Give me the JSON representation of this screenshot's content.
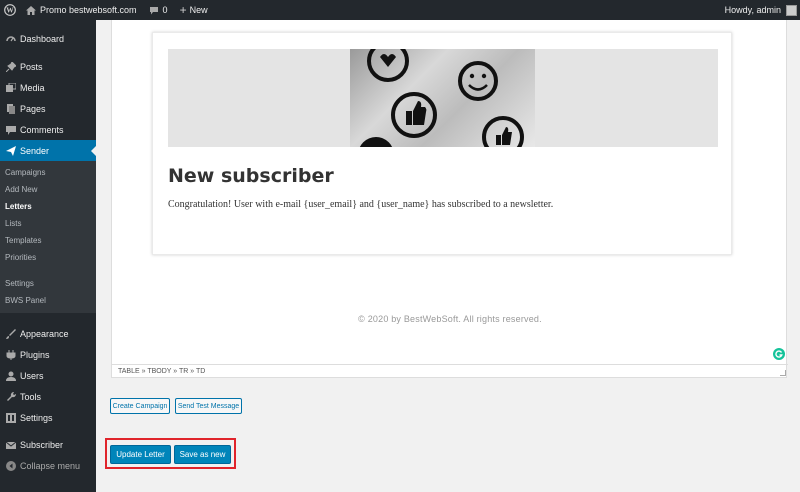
{
  "adminbar": {
    "site_name": "Promo bestwebsoft.com",
    "comments_count": "0",
    "new_label": "New",
    "howdy": "Howdy, admin"
  },
  "sidebar": {
    "top_items": [
      {
        "label": "Dashboard",
        "icon": "dashboard-icon"
      },
      {
        "label": "Posts",
        "icon": "pin-icon"
      },
      {
        "label": "Media",
        "icon": "media-icon"
      },
      {
        "label": "Pages",
        "icon": "page-icon"
      },
      {
        "label": "Comments",
        "icon": "comment-icon"
      },
      {
        "label": "Sender",
        "icon": "send-icon"
      }
    ],
    "submenu": [
      "Campaigns",
      "Add New",
      "Letters",
      "Lists",
      "Templates",
      "Priorities",
      "Settings",
      "BWS Panel"
    ],
    "bottom_items": [
      {
        "label": "Appearance",
        "icon": "brush-icon"
      },
      {
        "label": "Plugins",
        "icon": "plug-icon"
      },
      {
        "label": "Users",
        "icon": "users-icon"
      },
      {
        "label": "Tools",
        "icon": "wrench-icon"
      },
      {
        "label": "Settings",
        "icon": "settings-icon"
      },
      {
        "label": "Subscriber",
        "icon": "subscriber-icon"
      },
      {
        "label": "Collapse menu",
        "icon": "collapse-icon"
      }
    ]
  },
  "letter": {
    "title": "New subscriber",
    "body": "Congratulation! User with e-mail {user_email} and {user_name} has subscribed to a newsletter.",
    "footer": "© 2020 by BestWebSoft. All rights reserved."
  },
  "editor": {
    "path": "TABLE » TBODY » TR » TD"
  },
  "actions": {
    "create_campaign": "Create Campaign",
    "send_test": "Send Test Message",
    "update_letter": "Update Letter",
    "save_as_new": "Save as new"
  },
  "colors": {
    "admin_dark": "#23282d",
    "accent_blue": "#0073aa",
    "primary_button": "#0085ba",
    "highlight_red": "#e0242b"
  }
}
